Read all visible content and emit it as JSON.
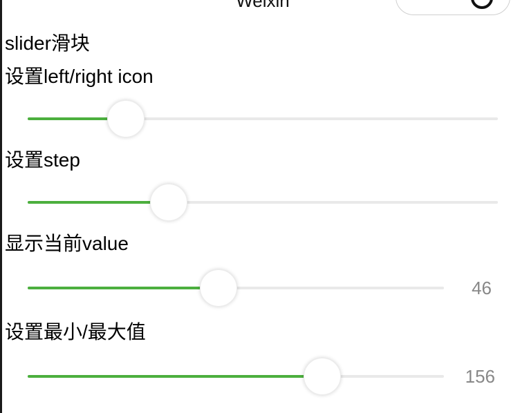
{
  "nav": {
    "title": "Weixin"
  },
  "sections": [
    {
      "heading": "slider滑块"
    },
    {
      "heading": "设置left/right icon",
      "slider": {
        "value_fraction": 0.21
      }
    },
    {
      "heading": "设置step",
      "slider": {
        "value_fraction": 0.3
      }
    },
    {
      "heading": "显示当前value",
      "slider": {
        "value": "46",
        "value_fraction": 0.46
      }
    },
    {
      "heading": "设置最小/最大值",
      "slider": {
        "value": "156"
      }
    }
  ],
  "colors": {
    "active": "#4caf3e",
    "inactive": "#e9e9e9",
    "value_text": "#888888"
  },
  "icons": {
    "capsule": "record-circle-icon"
  }
}
